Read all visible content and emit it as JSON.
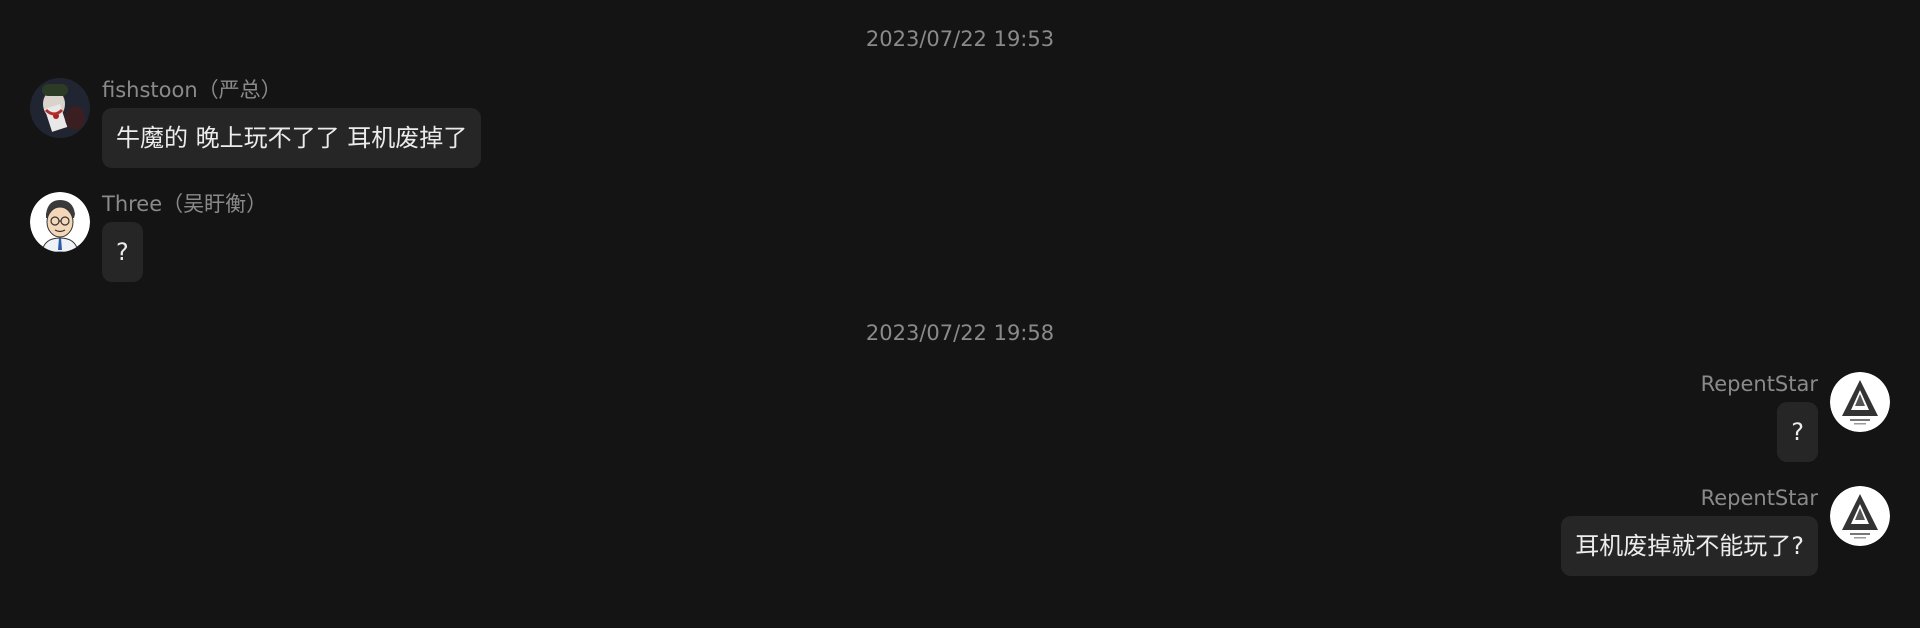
{
  "timestamps": [
    "2023/07/22 19:53",
    "2023/07/22 19:58"
  ],
  "messages": [
    {
      "sender": "fishstoon（严总）",
      "text": "牛魔的 晚上玩不了了 耳机废掉了",
      "avatar_icon": "joker-avatar"
    },
    {
      "sender": "Three（吴盱衡）",
      "text": "?",
      "avatar_icon": "cartoon-man-avatar"
    },
    {
      "sender": "RepentStar",
      "text": "?",
      "avatar_icon": "tri-logo-avatar"
    },
    {
      "sender": "RepentStar",
      "text": "耳机废掉就不能玩了?",
      "avatar_icon": "tri-logo-avatar"
    }
  ],
  "colors": {
    "background": "#141414",
    "bubble": "#262626",
    "text": "#ececec",
    "meta": "#8a8a8a"
  }
}
